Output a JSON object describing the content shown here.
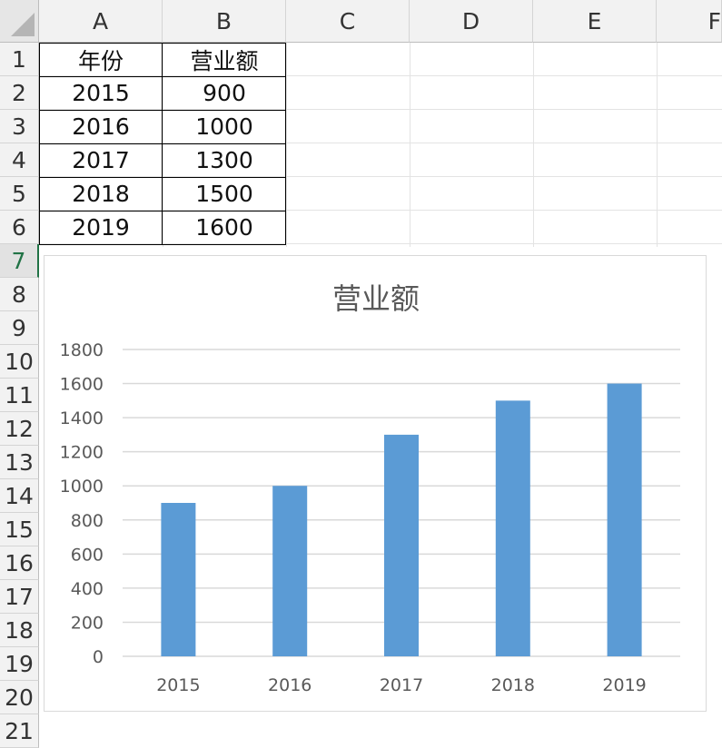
{
  "sheet": {
    "columns": [
      "A",
      "B",
      "C",
      "D",
      "E",
      "F"
    ],
    "rows": [
      "1",
      "2",
      "3",
      "4",
      "5",
      "6",
      "7",
      "8",
      "9",
      "10",
      "11",
      "12",
      "13",
      "14",
      "15",
      "16",
      "17",
      "18",
      "19",
      "20",
      "21"
    ],
    "active_row": "7",
    "header": {
      "year": "年份",
      "revenue": "营业额"
    },
    "data": [
      {
        "year": "2015",
        "revenue": "900"
      },
      {
        "year": "2016",
        "revenue": "1000"
      },
      {
        "year": "2017",
        "revenue": "1300"
      },
      {
        "year": "2018",
        "revenue": "1500"
      },
      {
        "year": "2019",
        "revenue": "1600"
      }
    ]
  },
  "chart_data": {
    "type": "bar",
    "title": "营业额",
    "categories": [
      "2015",
      "2016",
      "2017",
      "2018",
      "2019"
    ],
    "values": [
      900,
      1000,
      1300,
      1500,
      1600
    ],
    "ylim": [
      0,
      1800
    ],
    "yticks": [
      "0",
      "200",
      "400",
      "600",
      "800",
      "1000",
      "1200",
      "1400",
      "1600",
      "1800"
    ],
    "grid": true,
    "colors": {
      "bar": "#5b9bd5",
      "grid": "#d9d9d9",
      "axis_text": "#595959",
      "title": "#595959"
    }
  }
}
